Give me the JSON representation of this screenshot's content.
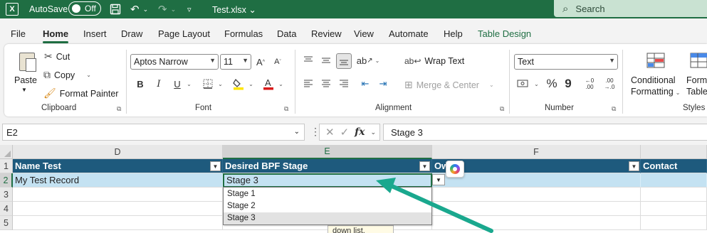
{
  "titlebar": {
    "app_icon": "X",
    "autosave_label": "AutoSave",
    "autosave_state": "Off",
    "filename": "Test.xlsx ⌄",
    "search_placeholder": "Search"
  },
  "tabs": [
    "File",
    "Home",
    "Insert",
    "Draw",
    "Page Layout",
    "Formulas",
    "Data",
    "Review",
    "View",
    "Automate",
    "Help",
    "Table Design"
  ],
  "active_tab": "Home",
  "clipboard": {
    "paste": "Paste",
    "cut": "Cut",
    "copy": "Copy",
    "format_painter": "Format Painter",
    "label": "Clipboard"
  },
  "font": {
    "family": "Aptos Narrow",
    "size": "11",
    "bold": "B",
    "italic": "I",
    "underline": "U",
    "label": "Font"
  },
  "alignment": {
    "wrap_text": "Wrap Text",
    "merge_center": "Merge & Center",
    "label": "Alignment"
  },
  "number": {
    "format": "Text",
    "percent": "%",
    "comma": "9",
    "label": "Number"
  },
  "styles": {
    "conditional_line1": "Conditional",
    "conditional_line2": "Formatting",
    "format_table_line1": "Format",
    "format_table_line2": "Table",
    "label": "Styles"
  },
  "formula_bar": {
    "name_box": "E2",
    "fx": "fx",
    "formula": "Stage 3"
  },
  "grid": {
    "columns": [
      "D",
      "E",
      "F"
    ],
    "rows": [
      "1",
      "2",
      "3",
      "4",
      "5"
    ],
    "headers": {
      "d": "Name Test",
      "e": "Desired BPF Stage",
      "f": "Ow",
      "g": "Contact"
    },
    "row2": {
      "d": "My Test Record",
      "e": "Stage 3"
    },
    "dropdown_options": [
      "Stage 1",
      "Stage 2",
      "Stage 3"
    ],
    "selected_option": "Stage 3",
    "tooltip": "down list."
  },
  "colors": {
    "excel_green": "#1f6e43",
    "table_header": "#1e5a7d",
    "table_row": "#c4e2f2",
    "annotation_arrow": "#1aa88e"
  }
}
